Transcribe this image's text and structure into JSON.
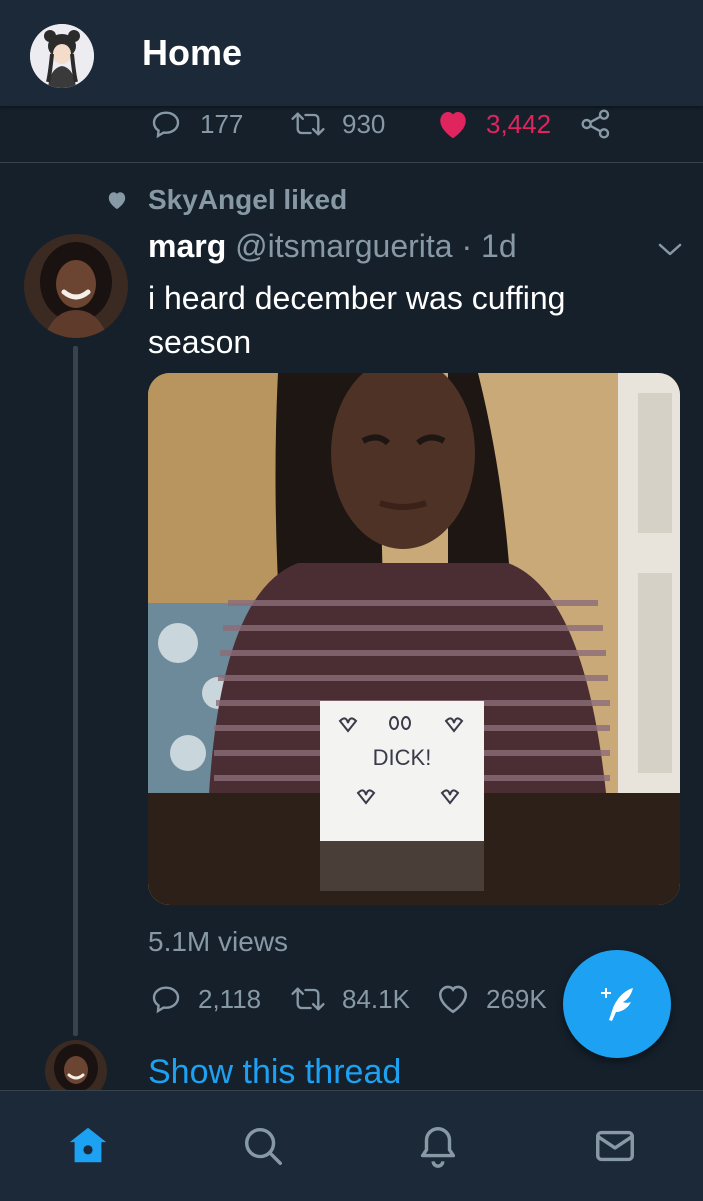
{
  "header": {
    "title": "Home"
  },
  "prev_tweet_actions": {
    "replies": "177",
    "retweets": "930",
    "likes": "3,442",
    "like_color": "#e0245e"
  },
  "tweet": {
    "social_context": "SkyAngel liked",
    "display_name": "marg",
    "handle_time": " @itsmarguerita · 1d",
    "text": "i heard december was cuffing season",
    "media_sign": {
      "line1": "DICK!"
    },
    "views": "5.1M views",
    "actions": {
      "replies": "2,118",
      "retweets": "84.1K",
      "likes": "269K"
    },
    "show_thread": "Show this thread"
  },
  "colors": {
    "background": "#15202b",
    "bar": "#1c2938",
    "accent": "#1da1f2",
    "muted": "#8899a6"
  },
  "icons": [
    "reply-icon",
    "retweet-icon",
    "like-icon",
    "share-icon",
    "chevron-down-icon",
    "compose-icon",
    "home-icon",
    "search-icon",
    "bell-icon",
    "mail-icon"
  ]
}
